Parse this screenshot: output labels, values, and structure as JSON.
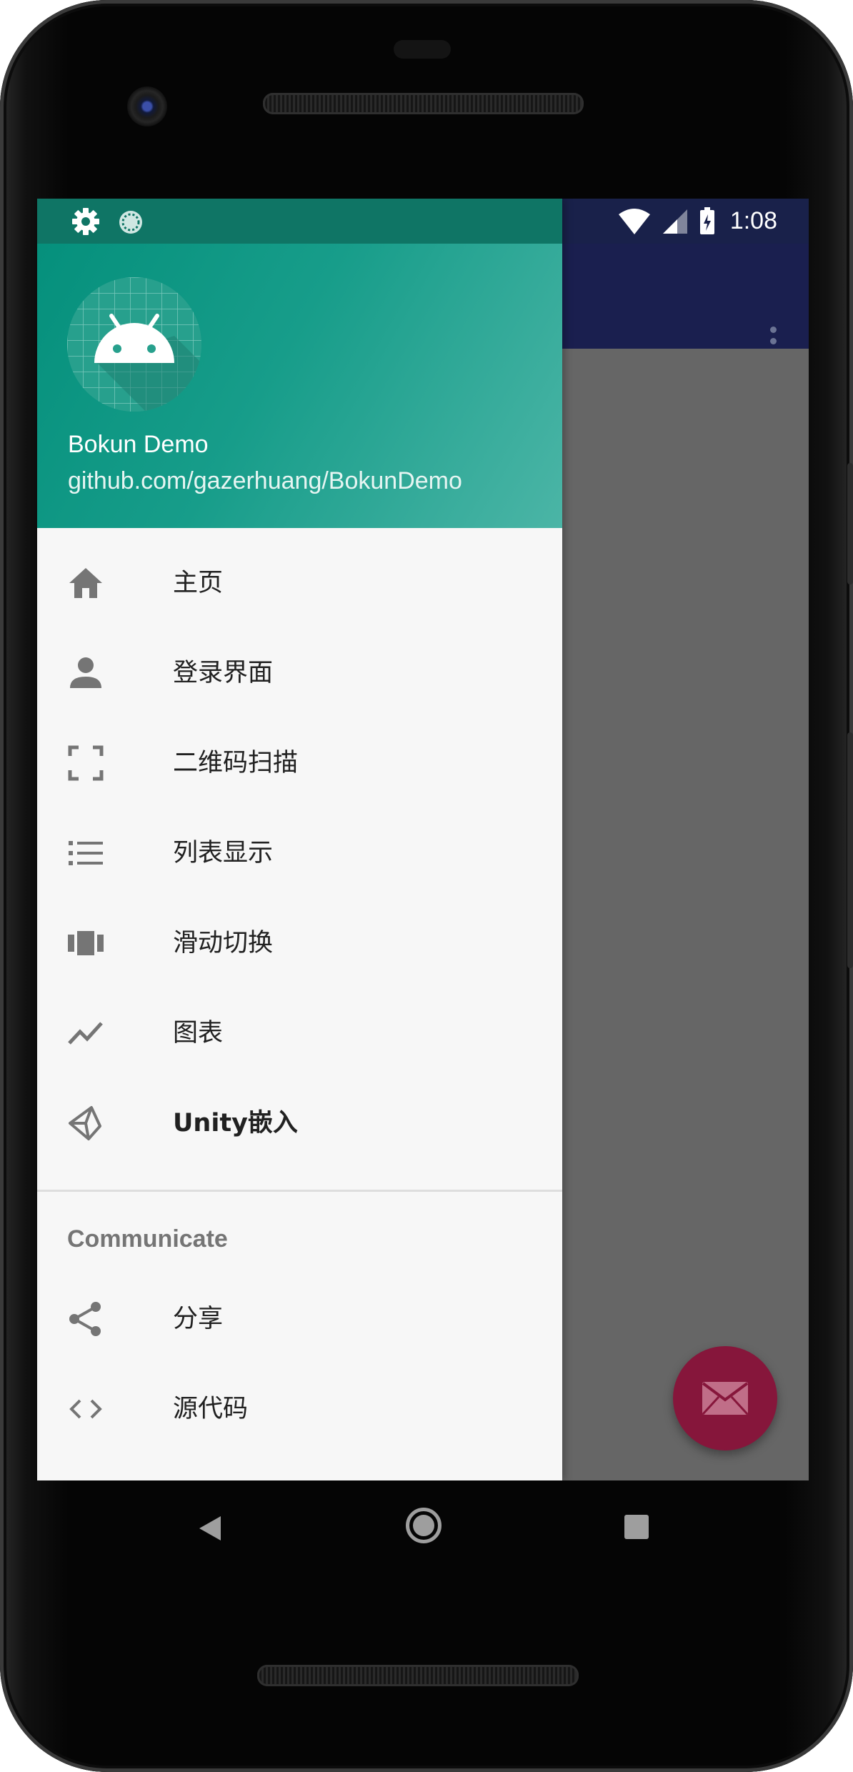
{
  "status_bar": {
    "time": "1:08",
    "left_icons": [
      "settings-icon",
      "sync-icon"
    ],
    "right_icons": [
      "wifi-icon",
      "signal-icon",
      "battery-charging-icon"
    ]
  },
  "app_bar": {
    "color": "#1a1f4f",
    "overflow_icon": "more-vert-icon"
  },
  "drawer": {
    "header": {
      "avatar_icon": "android-icon",
      "title": "Bokun Demo",
      "subtitle": "github.com/gazerhuang/BokunDemo",
      "gradient_start": "#05907c",
      "gradient_end": "#4bb5a6"
    },
    "items": [
      {
        "label": "主页",
        "icon": "home-icon"
      },
      {
        "label": "登录界面",
        "icon": "person-icon"
      },
      {
        "label": "二维码扫描",
        "icon": "scan-frame-icon"
      },
      {
        "label": "列表显示",
        "icon": "list-icon"
      },
      {
        "label": "滑动切换",
        "icon": "carousel-icon"
      },
      {
        "label": "图表",
        "icon": "chart-line-icon"
      },
      {
        "label": "Unity嵌入",
        "icon": "unity-icon"
      }
    ],
    "section_title": "Communicate",
    "section_items": [
      {
        "label": "分享",
        "icon": "share-icon"
      },
      {
        "label": "源代码",
        "icon": "code-icon"
      }
    ]
  },
  "fab": {
    "icon": "mail-icon",
    "color": "#86163b"
  },
  "nav_bar": {
    "buttons": [
      "back-icon",
      "home-circle-icon",
      "recents-icon"
    ]
  }
}
